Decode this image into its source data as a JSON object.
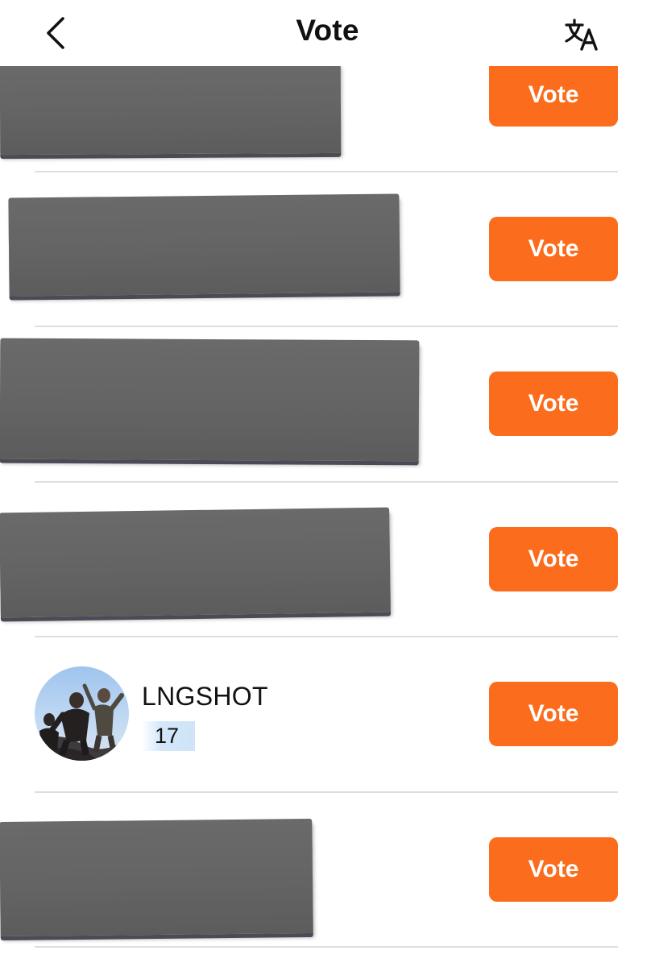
{
  "header": {
    "title": "Vote",
    "back_icon": "chevron-left-icon",
    "translate_icon": "translate-icon"
  },
  "colors": {
    "vote_button": "#fb6c1c",
    "vote_label": "#ffffff",
    "divider": "#dedede",
    "count_badge": "#cfe4f8"
  },
  "rows": [
    {
      "vote_label": "Vote",
      "redacted": true
    },
    {
      "vote_label": "Vote",
      "redacted": true
    },
    {
      "vote_label": "Vote",
      "redacted": true
    },
    {
      "vote_label": "Vote",
      "redacted": true
    },
    {
      "vote_label": "Vote",
      "redacted": false,
      "name": "LNGSHOT",
      "count": "17"
    },
    {
      "vote_label": "Vote",
      "redacted": true
    }
  ]
}
